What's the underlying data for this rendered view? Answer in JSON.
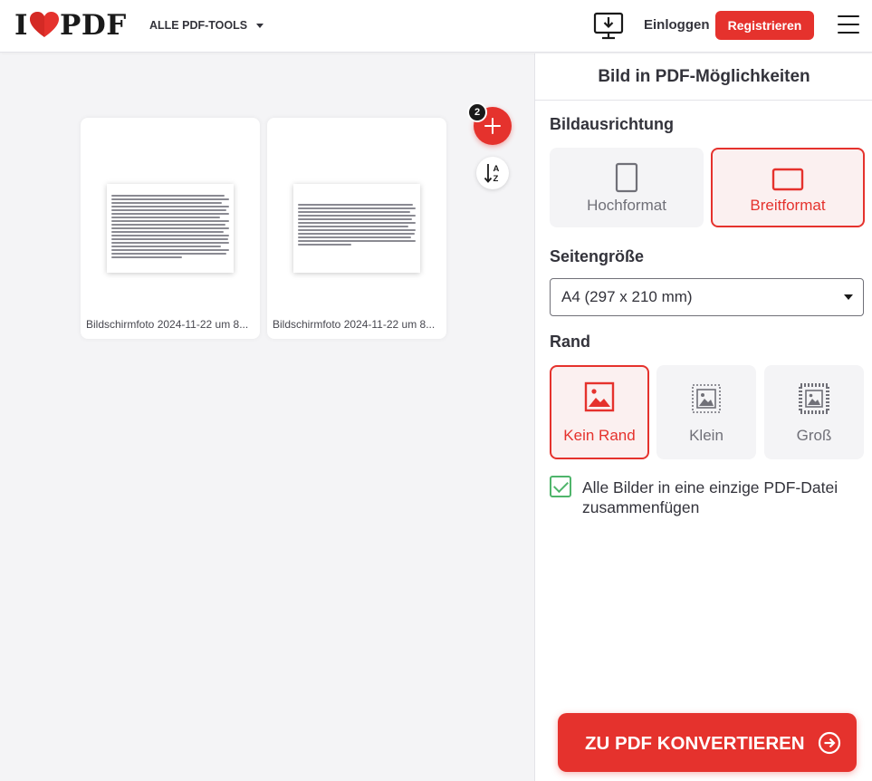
{
  "header": {
    "logo_left": "I",
    "logo_right": "PDF",
    "tools_menu": "ALLE PDF-TOOLS",
    "login": "Einloggen",
    "register": "Registrieren"
  },
  "workspace": {
    "file_count": "2",
    "files": [
      {
        "name": "Bildschirmfoto 2024-11-22 um 8..."
      },
      {
        "name": "Bildschirmfoto 2024-11-22 um 8..."
      }
    ]
  },
  "sidebar": {
    "title": "Bild in PDF-Möglichkeiten",
    "orientation": {
      "label": "Bildausrichtung",
      "options": [
        "Hochformat",
        "Breitformat"
      ],
      "selected": "Breitformat"
    },
    "page_size": {
      "label": "Seitengröße",
      "value": "A4 (297 x 210 mm)"
    },
    "margin": {
      "label": "Rand",
      "options": [
        "Kein Rand",
        "Klein",
        "Groß"
      ],
      "selected": "Kein Rand"
    },
    "merge": {
      "checked": true,
      "label": "Alle Bilder in eine einzige PDF-Datei zusammenfügen"
    },
    "convert_button": "ZU PDF KONVERTIEREN"
  },
  "colors": {
    "accent": "#e5322d",
    "check": "#4fb56b",
    "text": "#33333b",
    "muted": "#707078",
    "workspace_bg": "#f4f4f6"
  },
  "icons": [
    "heart-icon",
    "caret-down-icon",
    "desktop-download-icon",
    "hamburger-menu-icon",
    "plus-icon",
    "sort-az-icon",
    "portrait-icon",
    "landscape-icon",
    "no-margin-icon",
    "small-margin-icon",
    "big-margin-icon",
    "checkmark-icon",
    "arrow-right-circle-icon"
  ]
}
